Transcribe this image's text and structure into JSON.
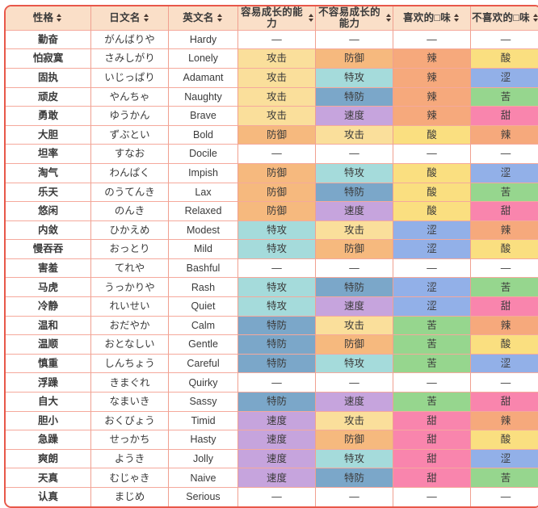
{
  "table": {
    "columns": [
      {
        "label": "性格",
        "sort_icon": "sort-updown-icon"
      },
      {
        "label": "日文名",
        "sort_icon": "sort-updown-icon"
      },
      {
        "label": "英文名",
        "sort_icon": "sort-updown-icon"
      },
      {
        "label": "容易成长的能力",
        "sort_icon": "sort-updown-icon"
      },
      {
        "label": "不容易成长的能力",
        "sort_icon": "sort-updown-icon"
      },
      {
        "label": "喜欢的□味",
        "sort_icon": "sort-updown-icon"
      },
      {
        "label": "不喜欢的□味",
        "sort_icon": "sort-updown-icon"
      }
    ],
    "empty_value": "—",
    "rows": [
      {
        "name": "勤奋",
        "jp": "がんばりや",
        "en": "Hardy",
        "up": "—",
        "down": "—",
        "like": "—",
        "dislike": "—"
      },
      {
        "name": "怕寂寞",
        "jp": "さみしがり",
        "en": "Lonely",
        "up": "攻击",
        "down": "防御",
        "like": "辣",
        "dislike": "酸"
      },
      {
        "name": "固执",
        "jp": "いじっぱり",
        "en": "Adamant",
        "up": "攻击",
        "down": "特攻",
        "like": "辣",
        "dislike": "涩"
      },
      {
        "name": "顽皮",
        "jp": "やんちゃ",
        "en": "Naughty",
        "up": "攻击",
        "down": "特防",
        "like": "辣",
        "dislike": "苦"
      },
      {
        "name": "勇敢",
        "jp": "ゆうかん",
        "en": "Brave",
        "up": "攻击",
        "down": "速度",
        "like": "辣",
        "dislike": "甜"
      },
      {
        "name": "大胆",
        "jp": "ずぶとい",
        "en": "Bold",
        "up": "防御",
        "down": "攻击",
        "like": "酸",
        "dislike": "辣"
      },
      {
        "name": "坦率",
        "jp": "すなお",
        "en": "Docile",
        "up": "—",
        "down": "—",
        "like": "—",
        "dislike": "—"
      },
      {
        "name": "淘气",
        "jp": "わんぱく",
        "en": "Impish",
        "up": "防御",
        "down": "特攻",
        "like": "酸",
        "dislike": "涩"
      },
      {
        "name": "乐天",
        "jp": "のうてんき",
        "en": "Lax",
        "up": "防御",
        "down": "特防",
        "like": "酸",
        "dislike": "苦"
      },
      {
        "name": "悠闲",
        "jp": "のんき",
        "en": "Relaxed",
        "up": "防御",
        "down": "速度",
        "like": "酸",
        "dislike": "甜"
      },
      {
        "name": "内敛",
        "jp": "ひかえめ",
        "en": "Modest",
        "up": "特攻",
        "down": "攻击",
        "like": "涩",
        "dislike": "辣"
      },
      {
        "name": "慢吞吞",
        "jp": "おっとり",
        "en": "Mild",
        "up": "特攻",
        "down": "防御",
        "like": "涩",
        "dislike": "酸"
      },
      {
        "name": "害羞",
        "jp": "てれや",
        "en": "Bashful",
        "up": "—",
        "down": "—",
        "like": "—",
        "dislike": "—"
      },
      {
        "name": "马虎",
        "jp": "うっかりや",
        "en": "Rash",
        "up": "特攻",
        "down": "特防",
        "like": "涩",
        "dislike": "苦"
      },
      {
        "name": "冷静",
        "jp": "れいせい",
        "en": "Quiet",
        "up": "特攻",
        "down": "速度",
        "like": "涩",
        "dislike": "甜"
      },
      {
        "name": "温和",
        "jp": "おだやか",
        "en": "Calm",
        "up": "特防",
        "down": "攻击",
        "like": "苦",
        "dislike": "辣"
      },
      {
        "name": "温顺",
        "jp": "おとなしい",
        "en": "Gentle",
        "up": "特防",
        "down": "防御",
        "like": "苦",
        "dislike": "酸"
      },
      {
        "name": "慎重",
        "jp": "しんちょう",
        "en": "Careful",
        "up": "特防",
        "down": "特攻",
        "like": "苦",
        "dislike": "涩"
      },
      {
        "name": "浮躁",
        "jp": "きまぐれ",
        "en": "Quirky",
        "up": "—",
        "down": "—",
        "like": "—",
        "dislike": "—"
      },
      {
        "name": "自大",
        "jp": "なまいき",
        "en": "Sassy",
        "up": "特防",
        "down": "速度",
        "like": "苦",
        "dislike": "甜"
      },
      {
        "name": "胆小",
        "jp": "おくびょう",
        "en": "Timid",
        "up": "速度",
        "down": "攻击",
        "like": "甜",
        "dislike": "辣"
      },
      {
        "name": "急躁",
        "jp": "せっかち",
        "en": "Hasty",
        "up": "速度",
        "down": "防御",
        "like": "甜",
        "dislike": "酸"
      },
      {
        "name": "爽朗",
        "jp": "ようき",
        "en": "Jolly",
        "up": "速度",
        "down": "特攻",
        "like": "甜",
        "dislike": "涩"
      },
      {
        "name": "天真",
        "jp": "むじゃき",
        "en": "Naive",
        "up": "速度",
        "down": "特防",
        "like": "甜",
        "dislike": "苦"
      },
      {
        "name": "认真",
        "jp": "まじめ",
        "en": "Serious",
        "up": "—",
        "down": "—",
        "like": "—",
        "dislike": "—"
      }
    ]
  },
  "value_colors": {
    "攻击": "#fadf9b",
    "防御": "#f6b97e",
    "特攻": "#a5dbdb",
    "特防": "#7ba7c9",
    "速度": "#c6a4dd",
    "辣": "#f6a97c",
    "酸": "#fadf80",
    "涩": "#92b0e8",
    "苦": "#96d68e",
    "甜": "#f985ad"
  },
  "theme": {
    "border_color": "#e8584a",
    "header_bg": "#fadfc8",
    "grid_color": "#f5a99c",
    "page_bg": "#ffffff"
  }
}
